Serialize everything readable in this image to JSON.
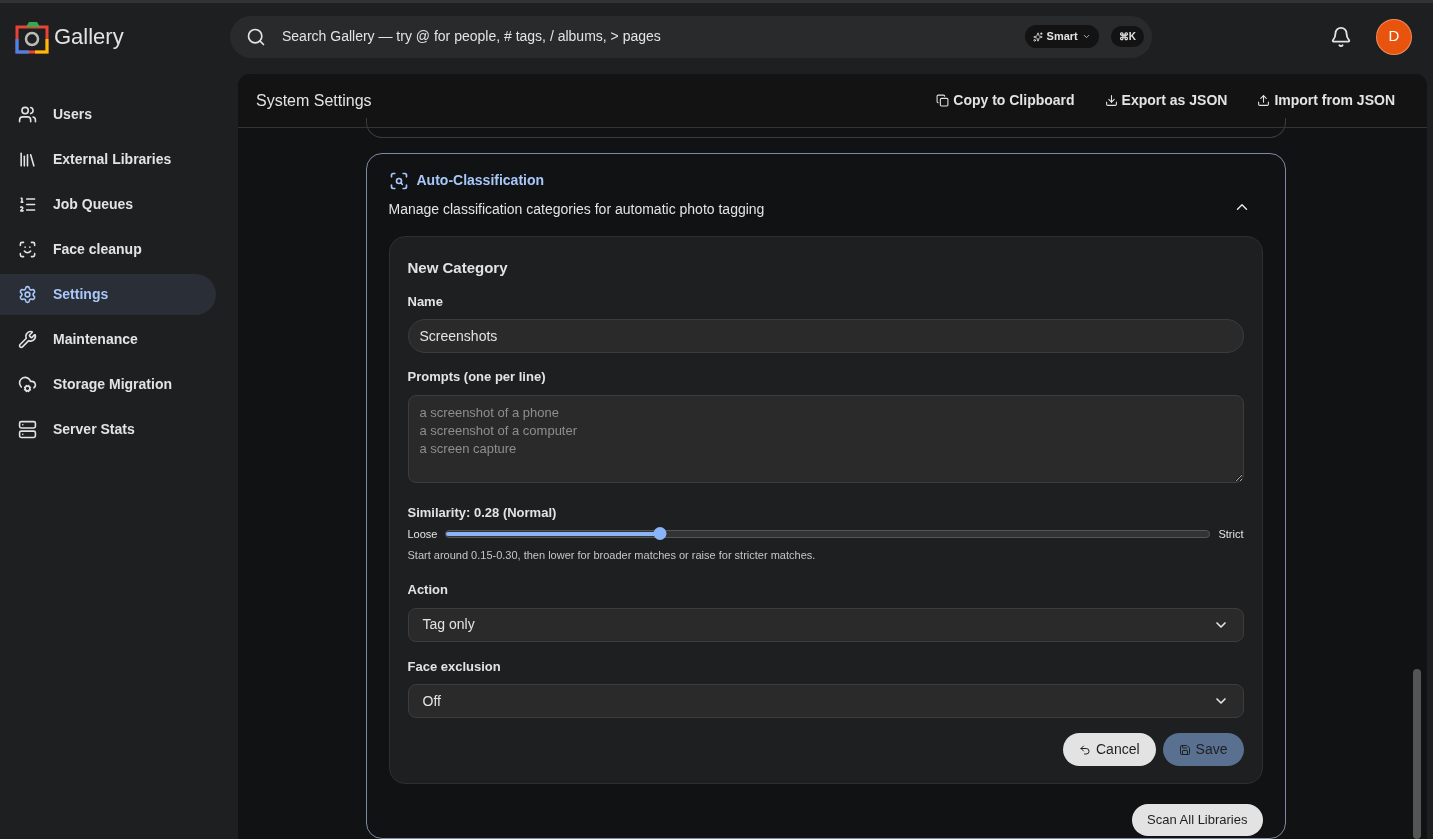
{
  "app": {
    "name": "Gallery"
  },
  "search": {
    "placeholder": "Search Gallery — try @ for people, # tags, / albums, > pages",
    "mode": "Smart",
    "shortcut": "⌘K"
  },
  "user": {
    "initial": "D"
  },
  "sidebar": {
    "items": [
      {
        "label": "Users",
        "kind": "users",
        "selected": false
      },
      {
        "label": "External Libraries",
        "kind": "library",
        "selected": false
      },
      {
        "label": "Job Queues",
        "kind": "queue",
        "selected": false
      },
      {
        "label": "Face cleanup",
        "kind": "face",
        "selected": false
      },
      {
        "label": "Settings",
        "kind": "gear",
        "selected": true
      },
      {
        "label": "Maintenance",
        "kind": "wrench",
        "selected": false
      },
      {
        "label": "Storage Migration",
        "kind": "cloud",
        "selected": false
      },
      {
        "label": "Server Stats",
        "kind": "server",
        "selected": false
      }
    ]
  },
  "header": {
    "title": "System Settings",
    "actions": [
      {
        "label": "Copy to Clipboard",
        "kind": "copy"
      },
      {
        "label": "Export as JSON",
        "kind": "download"
      },
      {
        "label": "Import from JSON",
        "kind": "upload"
      }
    ]
  },
  "section": {
    "title": "Auto-Classification",
    "description": "Manage classification categories for automatic photo tagging",
    "expanded": true,
    "form": {
      "title": "New Category",
      "name": {
        "label": "Name",
        "value": "Screenshots"
      },
      "prompts": {
        "label": "Prompts (one per line)",
        "placeholder": "a screenshot of a phone\na screenshot of a computer\na screen capture"
      },
      "similarity": {
        "label": "Similarity: 0.28 (Normal)",
        "min_label": "Loose",
        "max_label": "Strict",
        "level": 0.28,
        "hint": "Start around 0.15-0.30, then lower for broader matches or raise for stricter matches."
      },
      "action": {
        "label": "Action",
        "value": "Tag only"
      },
      "face_exclusion": {
        "label": "Face exclusion",
        "value": "Off"
      },
      "cancel": "Cancel",
      "save": "Save"
    },
    "scan_button": "Scan All Libraries"
  }
}
